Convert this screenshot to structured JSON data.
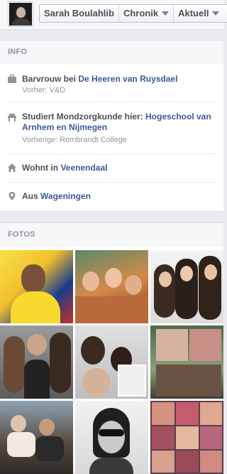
{
  "header": {
    "profile_name": "Sarah Boulahlib",
    "timeline_label": "Chronik",
    "current_label": "Aktuell"
  },
  "info": {
    "section_title": "INFO",
    "work": {
      "prefix": "Barvrouw bei ",
      "link": "De Heeren van Ruysdael",
      "sub": "Vorher: V&D"
    },
    "study": {
      "prefix": "Studiert Mondzorgkunde hier: ",
      "link": "Hogeschool van Arnhem en Nijmegen",
      "sub": "Vorherige: Rembrandt College"
    },
    "lives": {
      "prefix": "Wohnt in ",
      "link": "Veenendaal"
    },
    "from": {
      "prefix": "Aus ",
      "link": "Wageningen"
    }
  },
  "photos": {
    "section_title": "FOTOS"
  },
  "colors": {
    "link": "#3b5998",
    "muted": "#90949c",
    "text": "#4b4f56"
  }
}
